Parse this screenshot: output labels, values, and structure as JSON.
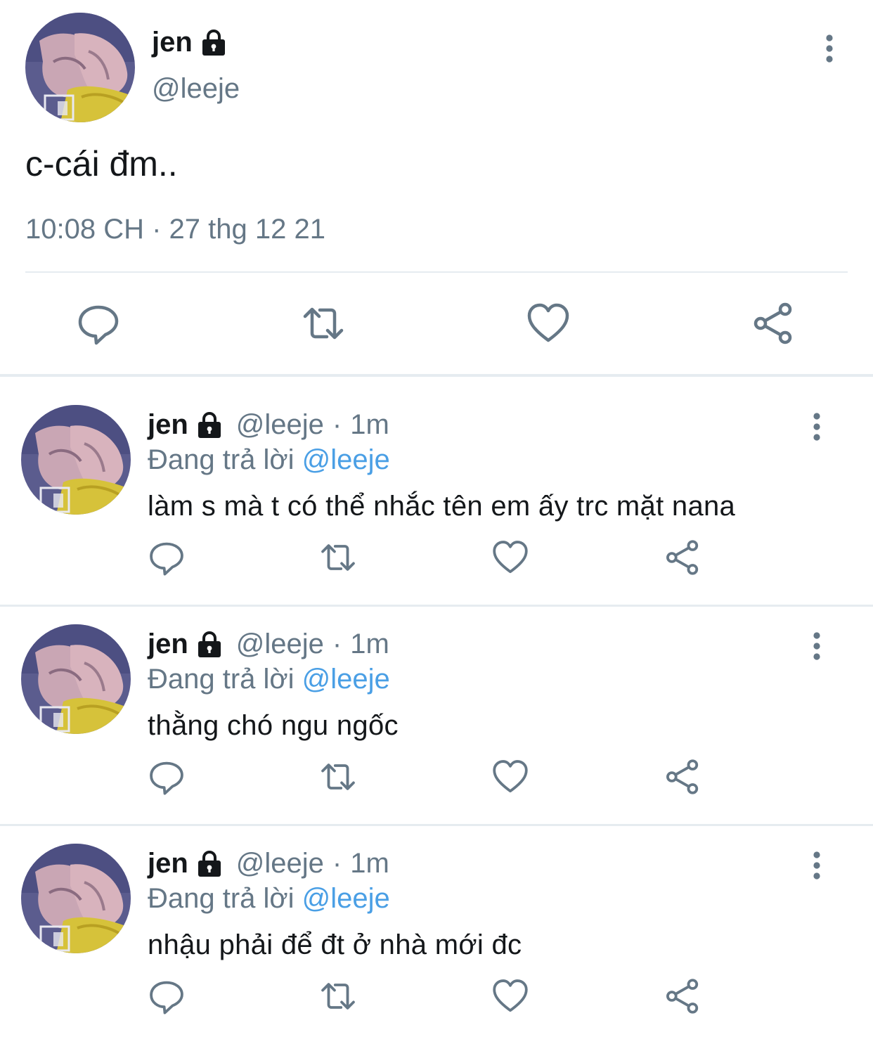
{
  "main_tweet": {
    "name": "jen",
    "handle": "@leeje",
    "text": "c-cái đm..",
    "timestamp": "10:08 CH · 27 thg 12 21",
    "icons": [
      "lock-icon",
      "more-icon",
      "reply-icon",
      "retweet-icon",
      "like-icon",
      "share-icon"
    ]
  },
  "replies": [
    {
      "name": "jen",
      "handle": "@leeje",
      "separator": "·",
      "age": "1m",
      "replying_label": "Đang trả lời",
      "replying_to": "@leeje",
      "text": "làm s mà t có thể nhắc tên em ấy trc mặt nana"
    },
    {
      "name": "jen",
      "handle": "@leeje",
      "separator": "·",
      "age": "1m",
      "replying_label": "Đang trả lời",
      "replying_to": "@leeje",
      "text": "thằng chó ngu ngốc"
    },
    {
      "name": "jen",
      "handle": "@leeje",
      "separator": "·",
      "age": "1m",
      "replying_label": "Đang trả lời",
      "replying_to": "@leeje",
      "text": "nhậu phải để đt ở nhà mới đc"
    }
  ],
  "colors": {
    "text": "#14171a",
    "secondary": "#657786",
    "link": "#4a9fe5",
    "divider": "#e6ecf0"
  }
}
